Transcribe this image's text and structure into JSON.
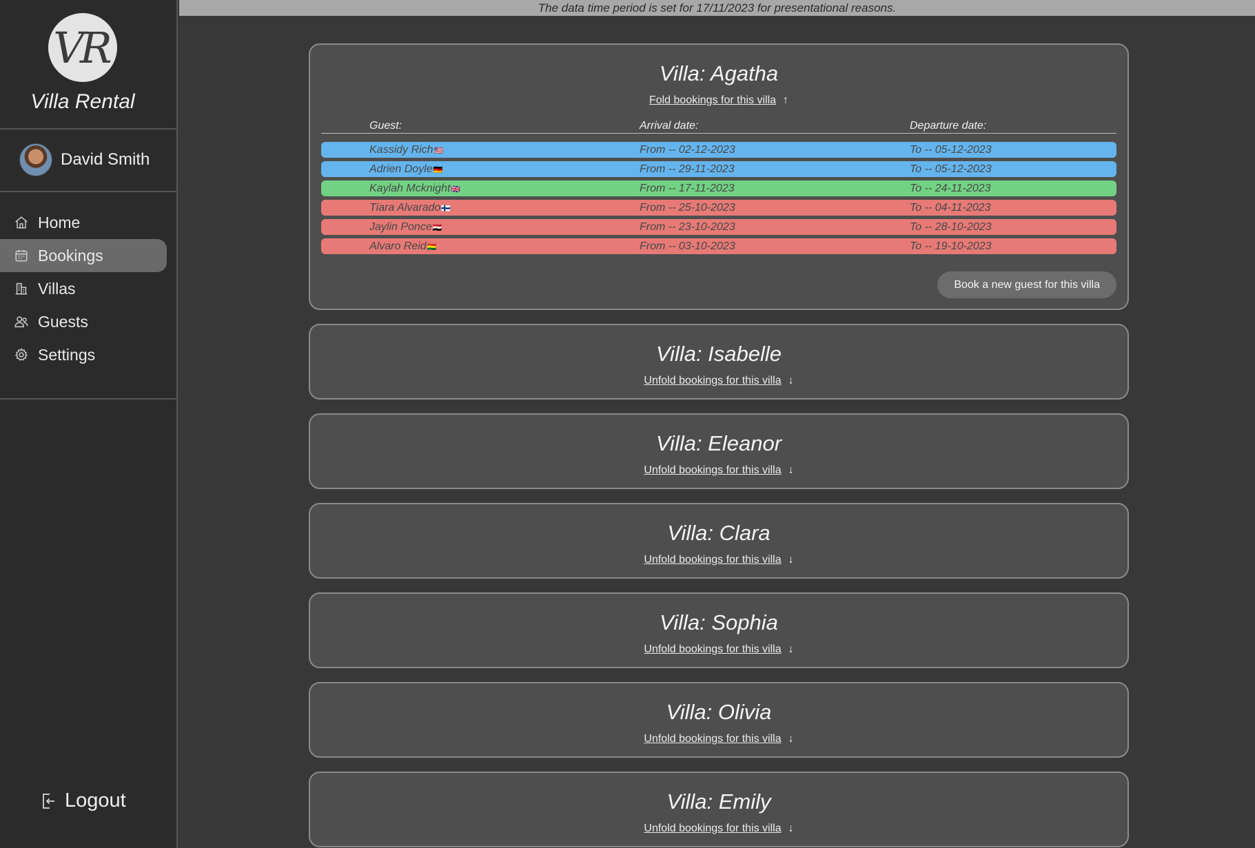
{
  "notice": "The data time period is set for 17/11/2023 for presentational reasons.",
  "sidebar": {
    "logo_text": "VR",
    "app_title": "Villa Rental",
    "user_name": "David Smith",
    "nav": [
      {
        "label": "Home",
        "icon": "home-icon"
      },
      {
        "label": "Bookings",
        "icon": "calendar-icon",
        "active": true
      },
      {
        "label": "Villas",
        "icon": "building-icon"
      },
      {
        "label": "Guests",
        "icon": "users-icon"
      },
      {
        "label": "Settings",
        "icon": "gear-icon"
      }
    ],
    "logout_label": "Logout"
  },
  "colors": {
    "upcoming": "#64b5ee",
    "current": "#72d283",
    "past": "#e77a76"
  },
  "villas": {
    "agatha": {
      "name": "Villa: Agatha",
      "fold_label": "Fold bookings for this villa",
      "columns": {
        "guest": "Guest:",
        "arrival": "Arrival date:",
        "departure": "Departure date:"
      },
      "bookings": [
        {
          "guest": "Kassidy Rich",
          "flag": "🇺🇸",
          "arrival": "From -- 02-12-2023",
          "departure": "To -- 05-12-2023",
          "status": "upcoming"
        },
        {
          "guest": "Adrien Doyle",
          "flag": "🇩🇪",
          "arrival": "From -- 29-11-2023",
          "departure": "To -- 05-12-2023",
          "status": "upcoming"
        },
        {
          "guest": "Kaylah Mcknight",
          "flag": "🇬🇧",
          "arrival": "From -- 17-11-2023",
          "departure": "To -- 24-11-2023",
          "status": "current"
        },
        {
          "guest": "Tiara Alvarado",
          "flag": "🇫🇮",
          "arrival": "From -- 25-10-2023",
          "departure": "To -- 04-11-2023",
          "status": "past"
        },
        {
          "guest": "Jaylin Ponce",
          "flag": "🇪🇬",
          "arrival": "From -- 23-10-2023",
          "departure": "To -- 28-10-2023",
          "status": "past"
        },
        {
          "guest": "Alvaro Reid",
          "flag": "🇧🇴",
          "arrival": "From -- 03-10-2023",
          "departure": "To -- 19-10-2023",
          "status": "past"
        }
      ],
      "book_button": "Book a new guest for this villa"
    },
    "collapsed": [
      {
        "name": "Villa: Isabelle",
        "unfold_label": "Unfold bookings for this villa"
      },
      {
        "name": "Villa: Eleanor",
        "unfold_label": "Unfold bookings for this villa"
      },
      {
        "name": "Villa: Clara",
        "unfold_label": "Unfold bookings for this villa"
      },
      {
        "name": "Villa: Sophia",
        "unfold_label": "Unfold bookings for this villa"
      },
      {
        "name": "Villa: Olivia",
        "unfold_label": "Unfold bookings for this villa"
      },
      {
        "name": "Villa: Emily",
        "unfold_label": "Unfold bookings for this villa"
      }
    ]
  }
}
